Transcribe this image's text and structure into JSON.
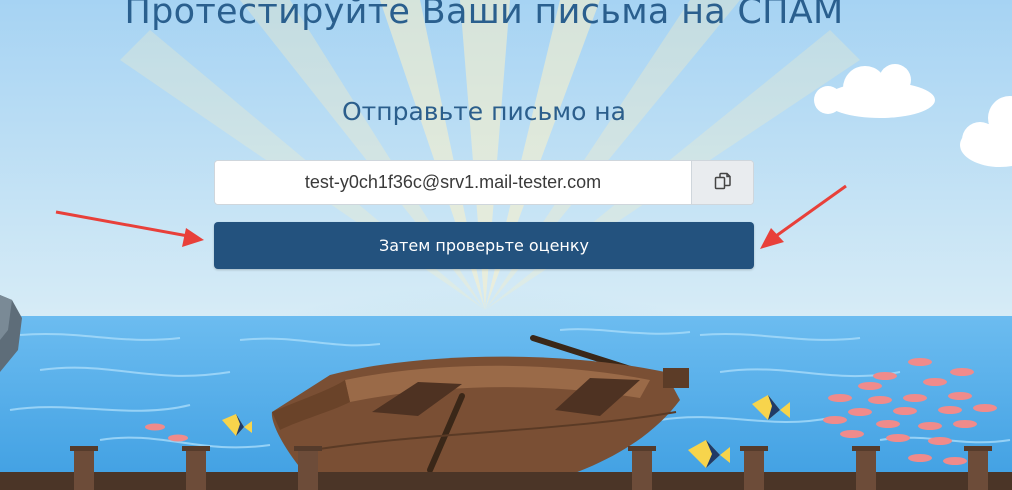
{
  "page": {
    "title": "Протестируйте Ваши письма на СПАМ",
    "subtitle": "Отправьте письмо на"
  },
  "email_box": {
    "address": "test-y0ch1f36c@srv1.mail-tester.com",
    "copy_icon": "copy-icon"
  },
  "check_button": {
    "label": "Затем проверьте оценку"
  },
  "annotations": {
    "arrow_color": "#e8403a",
    "arrows": [
      "left-arrow",
      "right-arrow"
    ]
  },
  "colors": {
    "title": "#2a5f8e",
    "button_bg": "#23527e",
    "sky": "#a9d7f5",
    "sea": "#4aa7e8"
  }
}
